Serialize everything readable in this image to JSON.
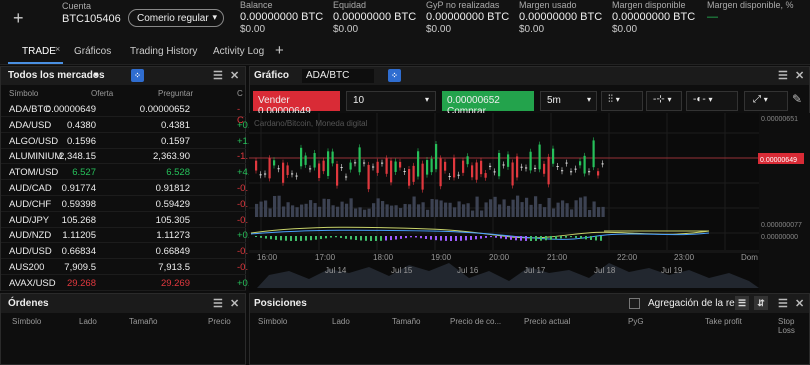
{
  "header": {
    "account_label": "Cuenta",
    "account_id": "BTC105406",
    "account_type": "Comerio regular",
    "stats": [
      {
        "label": "Balance",
        "value": "0.00000000 BTC",
        "sub": "$0.00"
      },
      {
        "label": "Equidad",
        "value": "0.00000000 BTC",
        "sub": "$0.00"
      },
      {
        "label": "GyP no realizadas",
        "value": "0.00000000 BTC",
        "sub": "$0.00"
      },
      {
        "label": "Margen usado",
        "value": "0.00000000 BTC",
        "sub": "$0.00"
      },
      {
        "label": "Margen disponible",
        "value": "0.00000000 BTC",
        "sub": "$0.00"
      },
      {
        "label": "Margen disponible, %",
        "value": "—",
        "sub": ""
      }
    ]
  },
  "tabs": [
    "TRADE",
    "Gráficos",
    "Trading History",
    "Activity Log"
  ],
  "markets": {
    "title": "Todos los mercados",
    "columns": [
      "Símbolo",
      "Oferta",
      "Preguntar",
      "C"
    ],
    "rows": [
      {
        "symbol": "ADA/BTC",
        "bid": "0.00000649",
        "ask": "0.00000652",
        "change": "-C",
        "bid_color": "white",
        "dir": "red"
      },
      {
        "symbol": "ADA/USD",
        "bid": "0.4380",
        "ask": "0.4381",
        "change": "+0.",
        "bid_color": "white",
        "dir": "green"
      },
      {
        "symbol": "ALGO/USD",
        "bid": "0.1596",
        "ask": "0.1597",
        "change": "+1.",
        "bid_color": "white",
        "dir": "green"
      },
      {
        "symbol": "ALUMINIUM",
        "bid": "2,348.15",
        "ask": "2,363.90",
        "change": "-1.",
        "bid_color": "white",
        "dir": "red"
      },
      {
        "symbol": "ATOM/USD",
        "bid": "6.527",
        "ask": "6.528",
        "change": "+4.",
        "bid_color": "green",
        "dir": "green"
      },
      {
        "symbol": "AUD/CAD",
        "bid": "0.91774",
        "ask": "0.91812",
        "change": "-0.",
        "bid_color": "white",
        "dir": "red"
      },
      {
        "symbol": "AUD/CHF",
        "bid": "0.59398",
        "ask": "0.59429",
        "change": "-0.",
        "bid_color": "white",
        "dir": "red"
      },
      {
        "symbol": "AUD/JPY",
        "bid": "105.268",
        "ask": "105.305",
        "change": "-0.",
        "bid_color": "white",
        "dir": "red"
      },
      {
        "symbol": "AUD/NZD",
        "bid": "1.11205",
        "ask": "1.11273",
        "change": "+0.",
        "bid_color": "white",
        "dir": "green"
      },
      {
        "symbol": "AUD/USD",
        "bid": "0.66834",
        "ask": "0.66849",
        "change": "-0.",
        "bid_color": "white",
        "dir": "red"
      },
      {
        "symbol": "AUS200",
        "bid": "7,909.5",
        "ask": "7,913.5",
        "change": "-0.",
        "bid_color": "white",
        "dir": "red"
      },
      {
        "symbol": "AVAX/USD",
        "bid": "29.268",
        "ask": "29.269",
        "change": "+0.",
        "bid_color": "red",
        "dir": "green"
      }
    ]
  },
  "chart": {
    "title": "Gráfico",
    "symbol": "ADA/BTC",
    "sell_label": "Vender",
    "sell_price": "0.00000649",
    "quantity": "10",
    "buy_price": "0.00000652",
    "buy_label": "Comprar",
    "timeframe": "5m",
    "watermark": "Cardano/Bitcoin, Moneda digital",
    "price_labels": [
      "0.00000651",
      "0.00000649",
      "0.000000077",
      "0.00000000"
    ],
    "time_labels": [
      "16:00",
      "17:00",
      "18:00",
      "19:00",
      "20:00",
      "21:00",
      "22:00",
      "23:00",
      "Dom"
    ],
    "nav_labels": [
      "Jul 14",
      "Jul 15",
      "Jul 16",
      "Jul 17",
      "Jul 18",
      "Jul 19"
    ]
  },
  "orders": {
    "title": "Órdenes",
    "columns": [
      "Símbolo",
      "Lado",
      "Tamaño",
      "Precio"
    ]
  },
  "positions": {
    "title": "Posiciones",
    "aggregation_label": "Agregación de la red",
    "columns": [
      "Símbolo",
      "Lado",
      "Tamaño",
      "Precio de co...",
      "Precio actual",
      "PyG",
      "Take profit",
      "Stop Loss"
    ]
  },
  "colors": {
    "green": "#26c05a",
    "red": "#e0383e",
    "accent": "#2f6dd0"
  }
}
